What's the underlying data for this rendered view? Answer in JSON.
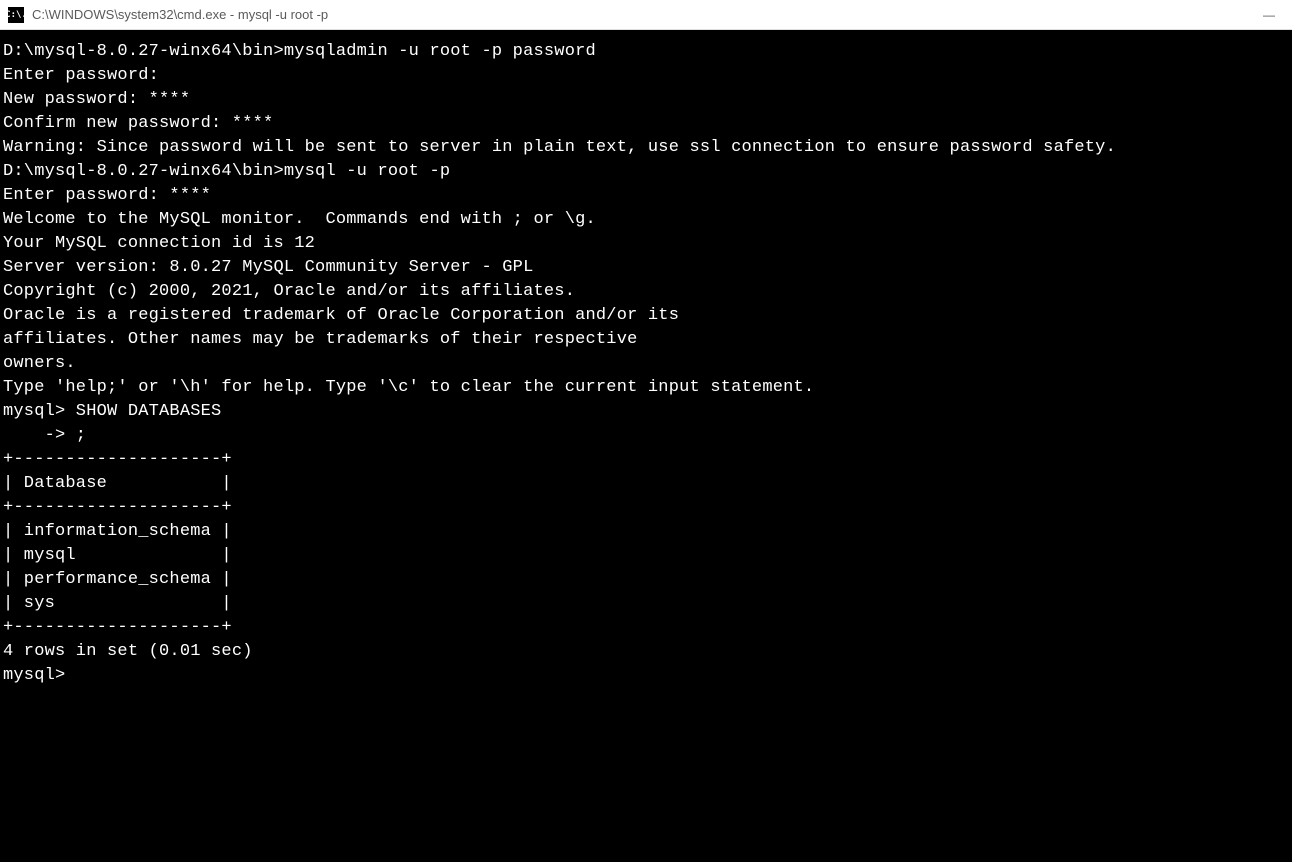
{
  "titlebar": {
    "icon_text": "C:\\.",
    "title": "C:\\WINDOWS\\system32\\cmd.exe - mysql  -u root -p"
  },
  "terminal": {
    "lines": [
      "",
      "D:\\mysql-8.0.27-winx64\\bin>mysqladmin -u root -p password",
      "Enter password:",
      "New password: ****",
      "Confirm new password: ****",
      "Warning: Since password will be sent to server in plain text, use ssl connection to ensure password safety.",
      "",
      "D:\\mysql-8.0.27-winx64\\bin>mysql -u root -p",
      "Enter password: ****",
      "Welcome to the MySQL monitor.  Commands end with ; or \\g.",
      "Your MySQL connection id is 12",
      "Server version: 8.0.27 MySQL Community Server - GPL",
      "",
      "Copyright (c) 2000, 2021, Oracle and/or its affiliates.",
      "",
      "Oracle is a registered trademark of Oracle Corporation and/or its",
      "affiliates. Other names may be trademarks of their respective",
      "owners.",
      "",
      "Type 'help;' or '\\h' for help. Type '\\c' to clear the current input statement.",
      "",
      "mysql> SHOW DATABASES",
      "    -> ;",
      "+--------------------+",
      "| Database           |",
      "+--------------------+",
      "| information_schema |",
      "| mysql              |",
      "| performance_schema |",
      "| sys                |",
      "+--------------------+",
      "4 rows in set (0.01 sec)",
      "",
      "mysql>"
    ]
  }
}
